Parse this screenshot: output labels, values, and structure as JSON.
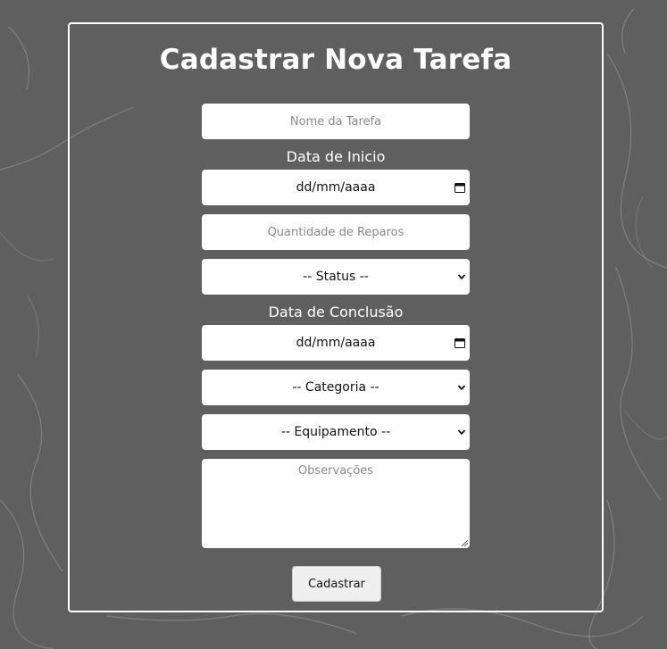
{
  "form": {
    "title": "Cadastrar Nova Tarefa",
    "task_name_placeholder": "Nome da Tarefa",
    "start_date_label": "Data de Inicio",
    "start_date_value": "dd/mm/aaaa",
    "repairs_placeholder": "Quantidade de Reparos",
    "status_selected": "-- Status --",
    "end_date_label": "Data de Conclusão",
    "end_date_value": "dd/mm/aaaa",
    "category_selected": "-- Categoria --",
    "equipment_selected": "-- Equipamento --",
    "notes_placeholder": "Observações",
    "submit_label": "Cadastrar"
  },
  "icons": {
    "date_picker": "calendar-icon",
    "select_arrow": "chevron-down-icon",
    "textarea_resize": "resize-grip-icon"
  },
  "colors": {
    "background": "#5f5f5f",
    "card_border": "#ffffff",
    "title_text": "#ffffff",
    "field_background": "#ffffff",
    "button_background": "#efefef"
  }
}
